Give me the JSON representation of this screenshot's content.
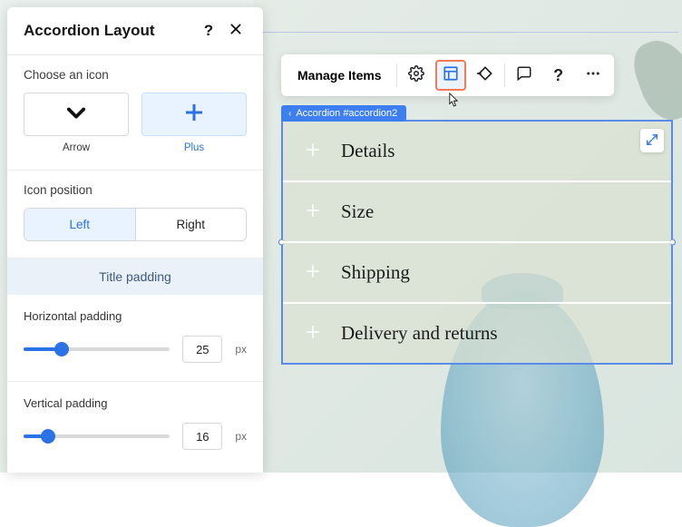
{
  "panel": {
    "title": "Accordion Layout",
    "choose_label": "Choose an icon",
    "icons": [
      {
        "label": "Arrow"
      },
      {
        "label": "Plus"
      }
    ],
    "icon_position_label": "Icon position",
    "positions": {
      "left": "Left",
      "right": "Right"
    },
    "title_padding_label": "Title padding",
    "hpad": {
      "label": "Horizontal padding",
      "value": "25",
      "unit": "px",
      "pct": 26
    },
    "vpad": {
      "label": "Vertical padding",
      "value": "16",
      "unit": "px",
      "pct": 17
    }
  },
  "toolbar": {
    "manage_label": "Manage Items"
  },
  "breadcrumb": {
    "label": "Accordion #accordion2"
  },
  "accordion": {
    "items": [
      {
        "title": "Details"
      },
      {
        "title": "Size"
      },
      {
        "title": "Shipping"
      },
      {
        "title": "Delivery and returns"
      }
    ]
  }
}
